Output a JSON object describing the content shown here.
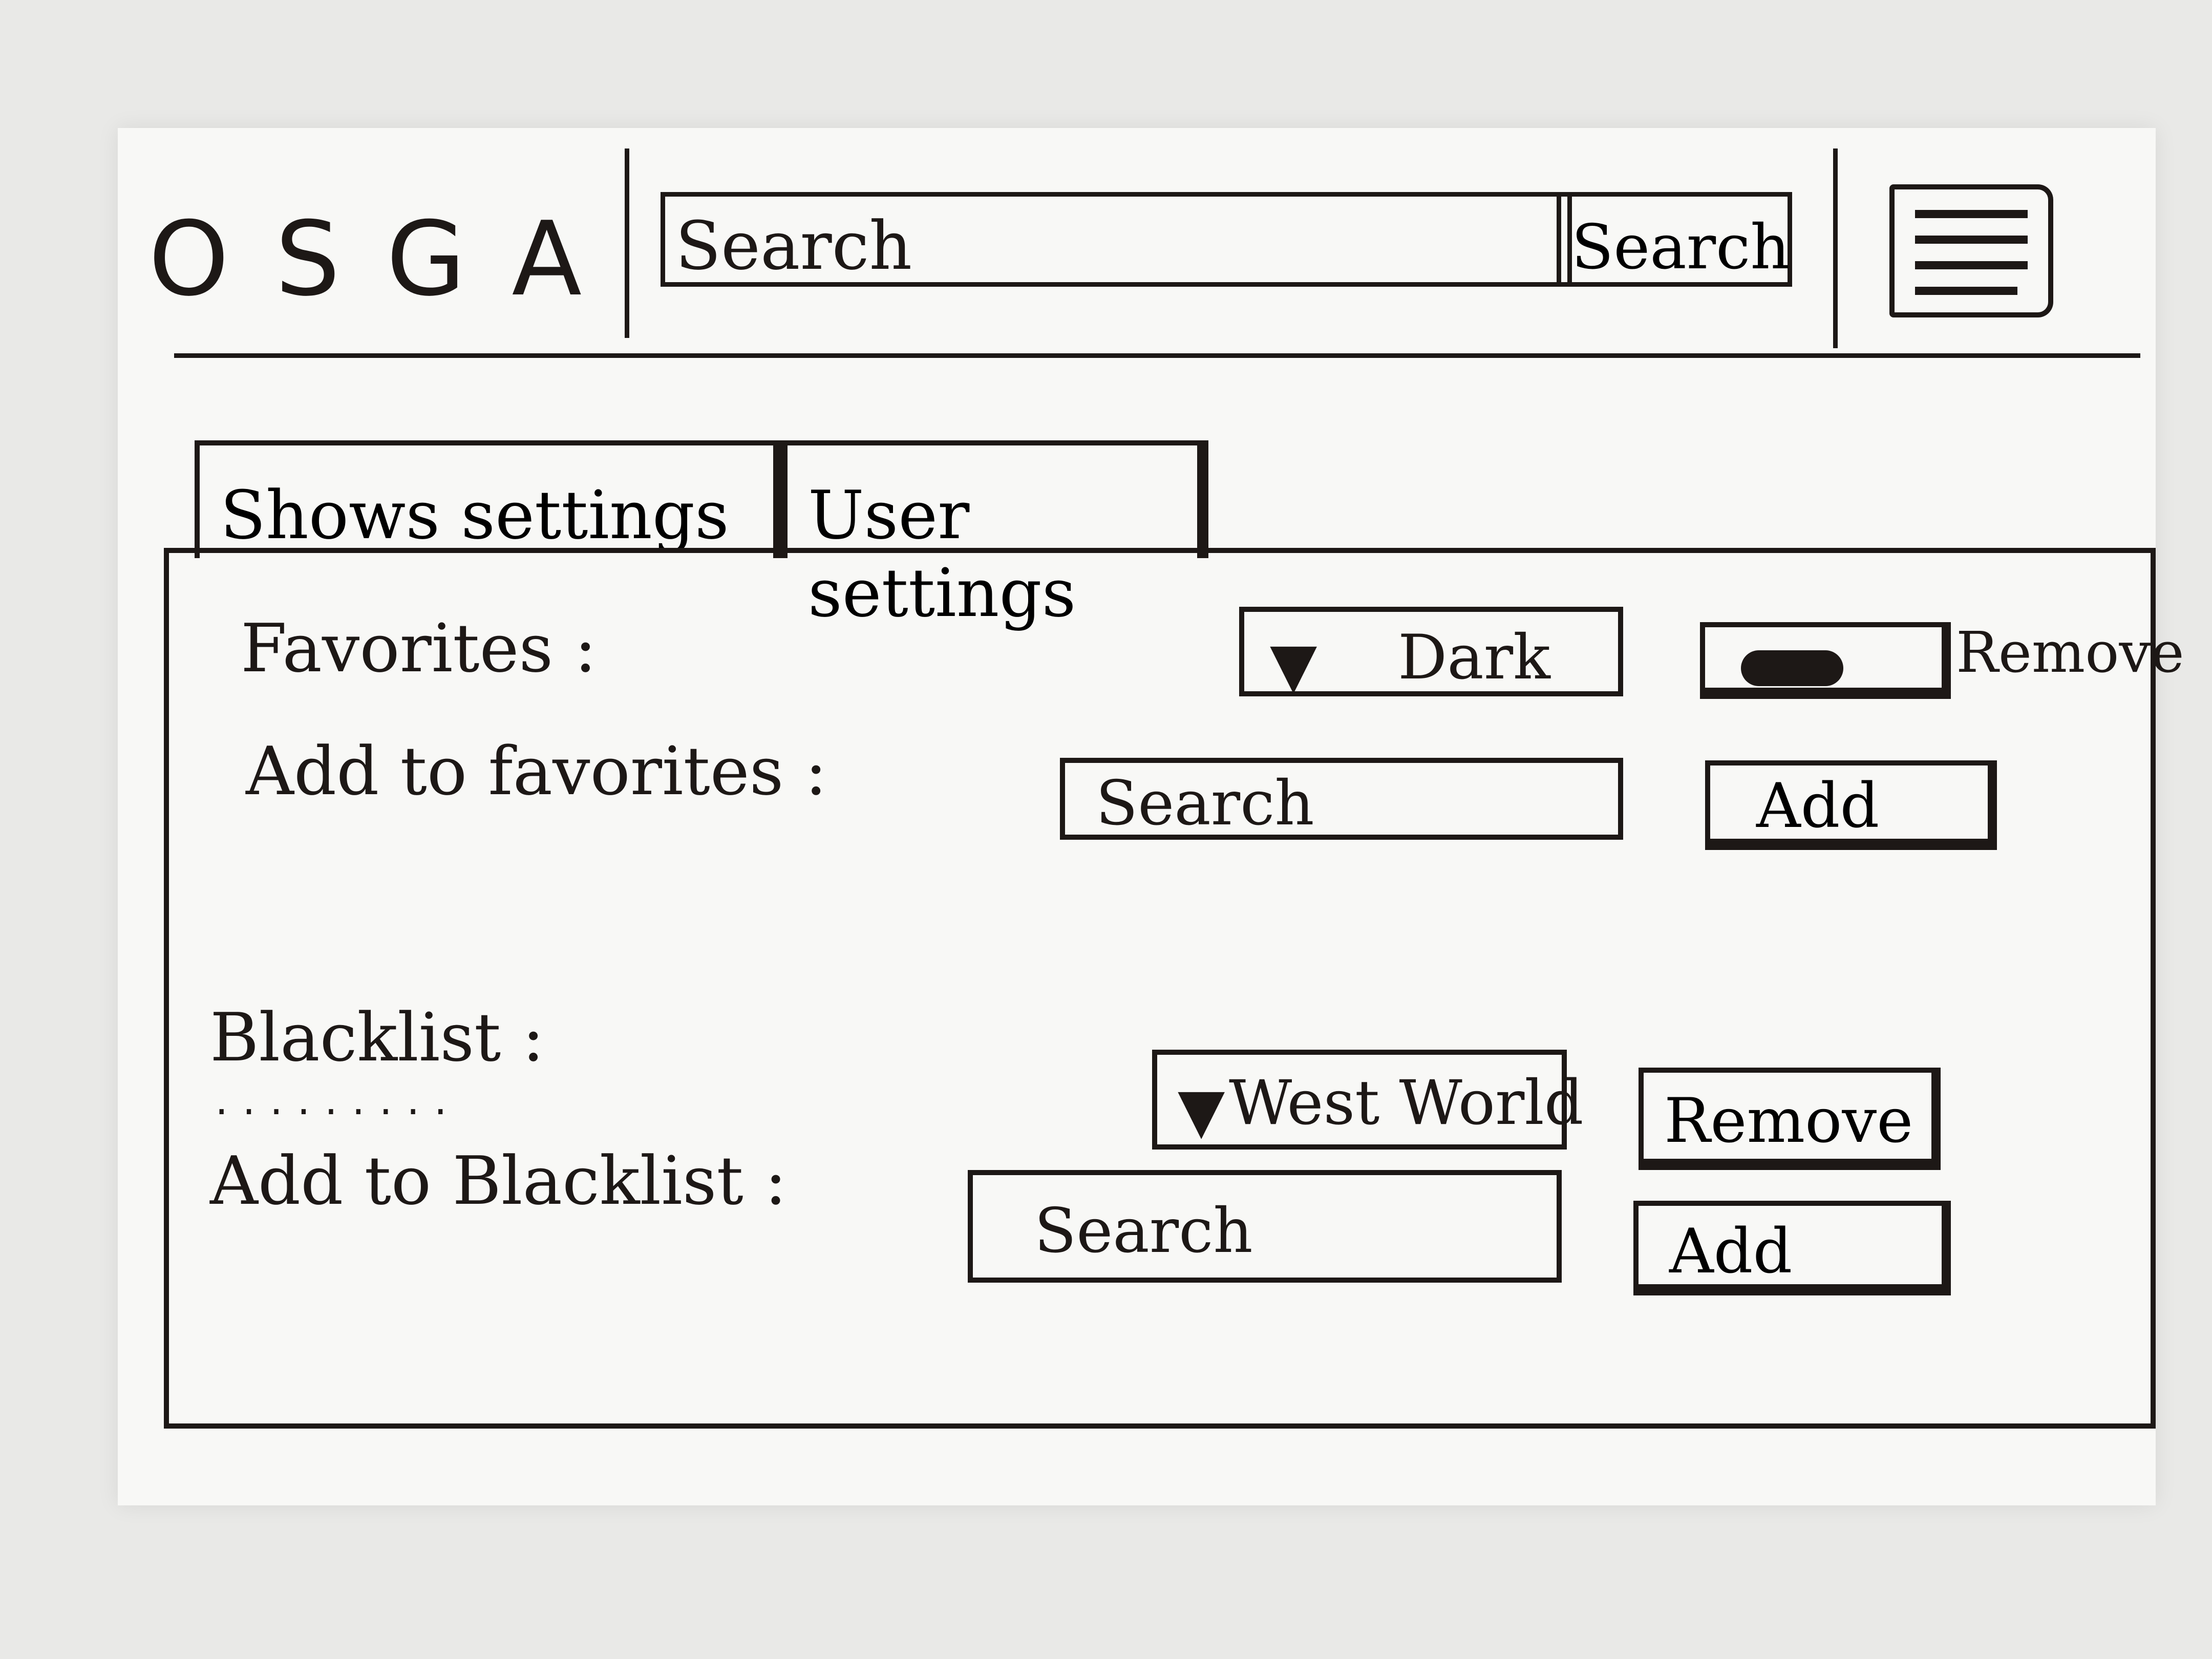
{
  "header": {
    "logo": "OSGA",
    "search_placeholder": "Search",
    "search_button_label": "Search"
  },
  "tabs": [
    {
      "label": "Shows settings"
    },
    {
      "label": "User settings"
    }
  ],
  "favorites": {
    "label": "Favorites :",
    "dropdown_caret": "▼",
    "dropdown_value": "Dark",
    "remove_label": "Remove",
    "add_label": "Add to favorites :",
    "add_search_placeholder": "Search",
    "add_button_label": "Add"
  },
  "blacklist": {
    "label": "Blacklist :",
    "dropdown_caret": "▼",
    "dropdown_value": "West World",
    "remove_button_label": "Remove",
    "add_label": "Add to Blacklist :",
    "add_search_placeholder": "Search",
    "add_button_label": "Add"
  },
  "icons": {
    "menu": "hamburger-menu-icon",
    "dropdown": "triangle-down-icon"
  }
}
